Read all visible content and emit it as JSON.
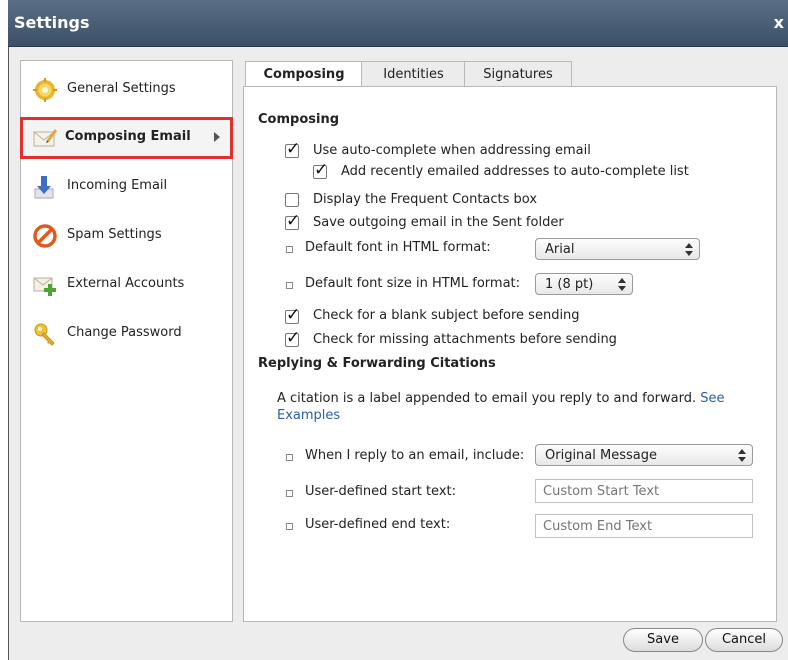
{
  "window": {
    "title": "Settings",
    "close_glyph": "x"
  },
  "sidebar": {
    "items": [
      {
        "label": "General Settings",
        "icon": "gear-icon"
      },
      {
        "label": "Composing Email",
        "icon": "envelope-pencil-icon",
        "selected": true
      },
      {
        "label": "Incoming Email",
        "icon": "download-arrow-icon"
      },
      {
        "label": "Spam Settings",
        "icon": "no-entry-icon"
      },
      {
        "label": "External Accounts",
        "icon": "envelope-plus-icon"
      },
      {
        "label": "Change Password",
        "icon": "key-icon"
      }
    ]
  },
  "tabs": [
    {
      "label": "Composing",
      "active": true
    },
    {
      "label": "Identities"
    },
    {
      "label": "Signatures"
    }
  ],
  "composing": {
    "title": "Composing",
    "autocomplete": {
      "label": "Use auto-complete when addressing email",
      "checked": true
    },
    "add_recent": {
      "label": "Add recently emailed addresses to auto-complete list",
      "checked": true
    },
    "frequent_contacts": {
      "label": "Display the Frequent Contacts box",
      "checked": false
    },
    "save_sent": {
      "label": "Save outgoing email in the Sent folder",
      "checked": true
    },
    "font": {
      "label": "Default font in HTML format:",
      "value": "Arial"
    },
    "font_size": {
      "label": "Default font size in HTML format:",
      "value": "1 (8 pt)"
    },
    "blank_subject": {
      "label": "Check for a blank subject before sending",
      "checked": true
    },
    "missing_attach": {
      "label": "Check for missing attachments before sending",
      "checked": true
    }
  },
  "citations": {
    "title": "Replying & Forwarding Citations",
    "description": "A citation is a label appended to email you reply to and forward.",
    "link_see": "See",
    "link_examples": "Examples",
    "reply_include": {
      "label": "When I reply to an email, include:",
      "value": "Original Message"
    },
    "start_text": {
      "label": "User-defined start text:",
      "placeholder": "Custom Start Text"
    },
    "end_text": {
      "label": "User-defined end text:",
      "placeholder": "Custom End Text"
    }
  },
  "footer": {
    "save_label": "Save",
    "cancel_label": "Cancel"
  },
  "colors": {
    "titlebar": "#4a5e76",
    "highlight": "#e0302a",
    "link": "#2a5db0"
  }
}
